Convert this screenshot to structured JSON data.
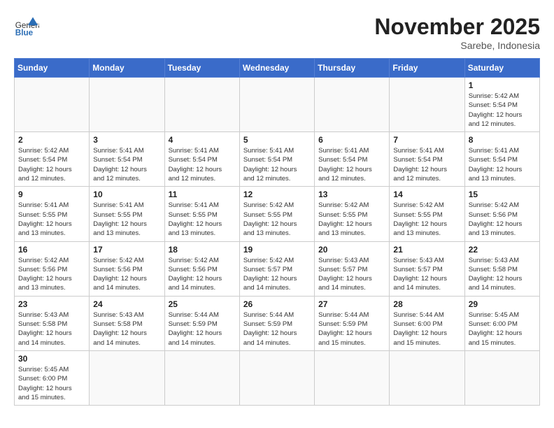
{
  "header": {
    "logo_general": "General",
    "logo_blue": "Blue",
    "month_title": "November 2025",
    "location": "Sarebe, Indonesia"
  },
  "weekdays": [
    "Sunday",
    "Monday",
    "Tuesday",
    "Wednesday",
    "Thursday",
    "Friday",
    "Saturday"
  ],
  "days": [
    {
      "date": "",
      "info": ""
    },
    {
      "date": "",
      "info": ""
    },
    {
      "date": "",
      "info": ""
    },
    {
      "date": "",
      "info": ""
    },
    {
      "date": "",
      "info": ""
    },
    {
      "date": "",
      "info": ""
    },
    {
      "date": "1",
      "info": "Sunrise: 5:42 AM\nSunset: 5:54 PM\nDaylight: 12 hours\nand 12 minutes."
    },
    {
      "date": "2",
      "info": "Sunrise: 5:42 AM\nSunset: 5:54 PM\nDaylight: 12 hours\nand 12 minutes."
    },
    {
      "date": "3",
      "info": "Sunrise: 5:41 AM\nSunset: 5:54 PM\nDaylight: 12 hours\nand 12 minutes."
    },
    {
      "date": "4",
      "info": "Sunrise: 5:41 AM\nSunset: 5:54 PM\nDaylight: 12 hours\nand 12 minutes."
    },
    {
      "date": "5",
      "info": "Sunrise: 5:41 AM\nSunset: 5:54 PM\nDaylight: 12 hours\nand 12 minutes."
    },
    {
      "date": "6",
      "info": "Sunrise: 5:41 AM\nSunset: 5:54 PM\nDaylight: 12 hours\nand 12 minutes."
    },
    {
      "date": "7",
      "info": "Sunrise: 5:41 AM\nSunset: 5:54 PM\nDaylight: 12 hours\nand 12 minutes."
    },
    {
      "date": "8",
      "info": "Sunrise: 5:41 AM\nSunset: 5:54 PM\nDaylight: 12 hours\nand 13 minutes."
    },
    {
      "date": "9",
      "info": "Sunrise: 5:41 AM\nSunset: 5:55 PM\nDaylight: 12 hours\nand 13 minutes."
    },
    {
      "date": "10",
      "info": "Sunrise: 5:41 AM\nSunset: 5:55 PM\nDaylight: 12 hours\nand 13 minutes."
    },
    {
      "date": "11",
      "info": "Sunrise: 5:41 AM\nSunset: 5:55 PM\nDaylight: 12 hours\nand 13 minutes."
    },
    {
      "date": "12",
      "info": "Sunrise: 5:42 AM\nSunset: 5:55 PM\nDaylight: 12 hours\nand 13 minutes."
    },
    {
      "date": "13",
      "info": "Sunrise: 5:42 AM\nSunset: 5:55 PM\nDaylight: 12 hours\nand 13 minutes."
    },
    {
      "date": "14",
      "info": "Sunrise: 5:42 AM\nSunset: 5:55 PM\nDaylight: 12 hours\nand 13 minutes."
    },
    {
      "date": "15",
      "info": "Sunrise: 5:42 AM\nSunset: 5:56 PM\nDaylight: 12 hours\nand 13 minutes."
    },
    {
      "date": "16",
      "info": "Sunrise: 5:42 AM\nSunset: 5:56 PM\nDaylight: 12 hours\nand 13 minutes."
    },
    {
      "date": "17",
      "info": "Sunrise: 5:42 AM\nSunset: 5:56 PM\nDaylight: 12 hours\nand 14 minutes."
    },
    {
      "date": "18",
      "info": "Sunrise: 5:42 AM\nSunset: 5:56 PM\nDaylight: 12 hours\nand 14 minutes."
    },
    {
      "date": "19",
      "info": "Sunrise: 5:42 AM\nSunset: 5:57 PM\nDaylight: 12 hours\nand 14 minutes."
    },
    {
      "date": "20",
      "info": "Sunrise: 5:43 AM\nSunset: 5:57 PM\nDaylight: 12 hours\nand 14 minutes."
    },
    {
      "date": "21",
      "info": "Sunrise: 5:43 AM\nSunset: 5:57 PM\nDaylight: 12 hours\nand 14 minutes."
    },
    {
      "date": "22",
      "info": "Sunrise: 5:43 AM\nSunset: 5:58 PM\nDaylight: 12 hours\nand 14 minutes."
    },
    {
      "date": "23",
      "info": "Sunrise: 5:43 AM\nSunset: 5:58 PM\nDaylight: 12 hours\nand 14 minutes."
    },
    {
      "date": "24",
      "info": "Sunrise: 5:43 AM\nSunset: 5:58 PM\nDaylight: 12 hours\nand 14 minutes."
    },
    {
      "date": "25",
      "info": "Sunrise: 5:44 AM\nSunset: 5:59 PM\nDaylight: 12 hours\nand 14 minutes."
    },
    {
      "date": "26",
      "info": "Sunrise: 5:44 AM\nSunset: 5:59 PM\nDaylight: 12 hours\nand 14 minutes."
    },
    {
      "date": "27",
      "info": "Sunrise: 5:44 AM\nSunset: 5:59 PM\nDaylight: 12 hours\nand 15 minutes."
    },
    {
      "date": "28",
      "info": "Sunrise: 5:44 AM\nSunset: 6:00 PM\nDaylight: 12 hours\nand 15 minutes."
    },
    {
      "date": "29",
      "info": "Sunrise: 5:45 AM\nSunset: 6:00 PM\nDaylight: 12 hours\nand 15 minutes."
    },
    {
      "date": "30",
      "info": "Sunrise: 5:45 AM\nSunset: 6:00 PM\nDaylight: 12 hours\nand 15 minutes."
    },
    {
      "date": "",
      "info": ""
    },
    {
      "date": "",
      "info": ""
    },
    {
      "date": "",
      "info": ""
    },
    {
      "date": "",
      "info": ""
    },
    {
      "date": "",
      "info": ""
    },
    {
      "date": "",
      "info": ""
    }
  ]
}
